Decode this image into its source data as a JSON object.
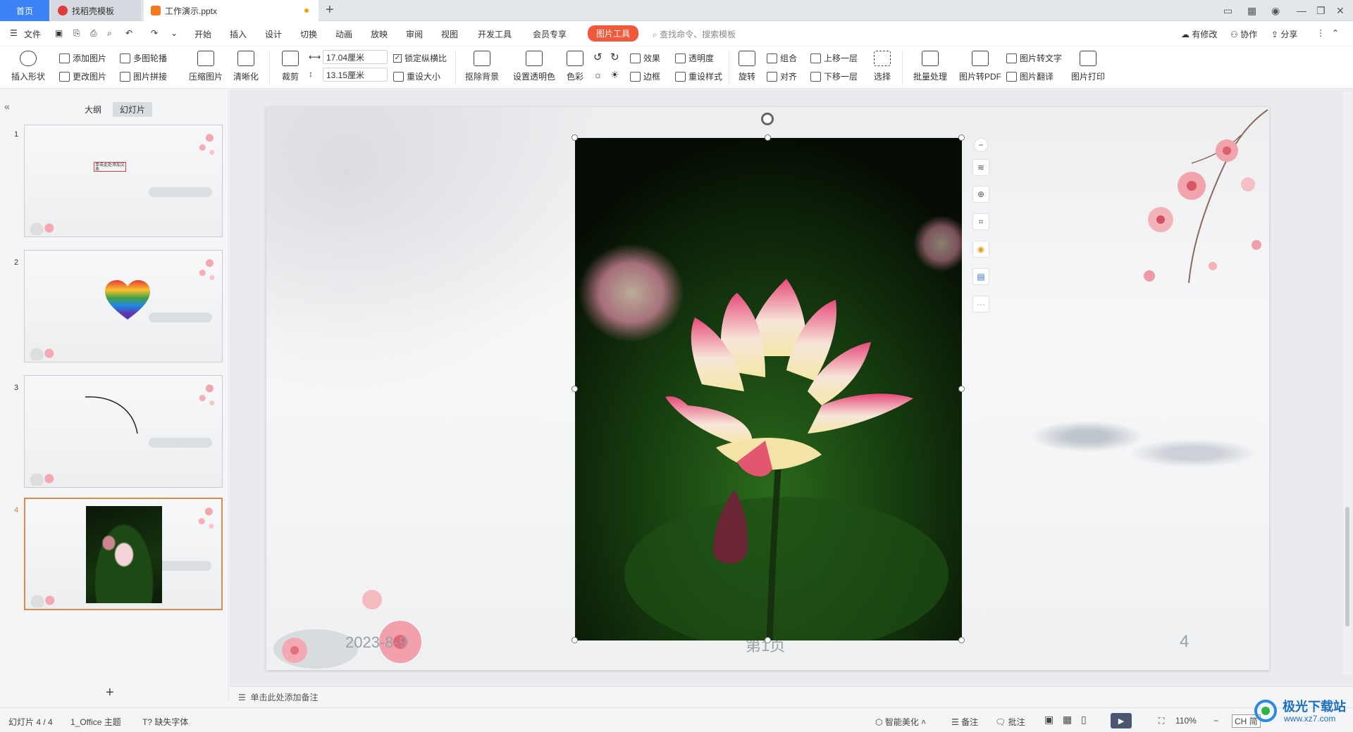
{
  "tabs": {
    "home": "首页",
    "template": "找稻壳模板",
    "doc": "工作演示.pptx"
  },
  "menu": [
    "文件",
    "开始",
    "插入",
    "设计",
    "切换",
    "动画",
    "放映",
    "审阅",
    "视图",
    "开发工具",
    "会员专享"
  ],
  "picture_tools_tab": "图片工具",
  "search_placeholder": "查找命令、搜索模板",
  "right_actions": {
    "modified": "有修改",
    "collab": "协作",
    "share": "分享"
  },
  "ribbon": {
    "insert_shape": "插入形状",
    "add_picture": "添加图片",
    "multi_outline": "多图轮播",
    "change_picture": "更改图片",
    "picture_merge": "图片拼接",
    "compress": "压缩图片",
    "clarity": "清晰化",
    "crop": "裁剪",
    "width_value": "17.04厘米",
    "height_value": "13.15厘米",
    "lock_ratio": "锁定纵横比",
    "reset_size": "重设大小",
    "remove_bg": "抠除背景",
    "set_transparent": "设置透明色",
    "color": "色彩",
    "effect": "效果",
    "transparency": "透明度",
    "border": "边框",
    "reset_style": "重设样式",
    "rotate": "旋转",
    "group": "组合",
    "align": "对齐",
    "bring_forward": "上移一层",
    "send_backward": "下移一层",
    "select": "选择",
    "batch": "批量处理",
    "to_pdf": "图片转PDF",
    "to_text": "图片转文字",
    "translate": "图片翻译",
    "print": "图片打印"
  },
  "left_panel": {
    "outline_tab": "大纲",
    "slides_tab": "幻灯片",
    "slides": [
      {
        "num": "1",
        "text": "单击此处添加文本"
      },
      {
        "num": "2"
      },
      {
        "num": "3"
      },
      {
        "num": "4"
      }
    ]
  },
  "slide": {
    "date": "2023-8-9",
    "page_text": "第1页",
    "page_number": "4"
  },
  "notes_placeholder": "单击此处添加备注",
  "status": {
    "slide_info": "幻灯片 4 / 4",
    "theme": "1_Office 主题",
    "missing_font": "缺失字体",
    "smart_beautify": "智能美化",
    "notes": "备注",
    "comment": "批注",
    "zoom": "110%",
    "ime": "CH 简"
  },
  "watermark": {
    "text": "极光下载站",
    "url": "www.xz7.com"
  }
}
